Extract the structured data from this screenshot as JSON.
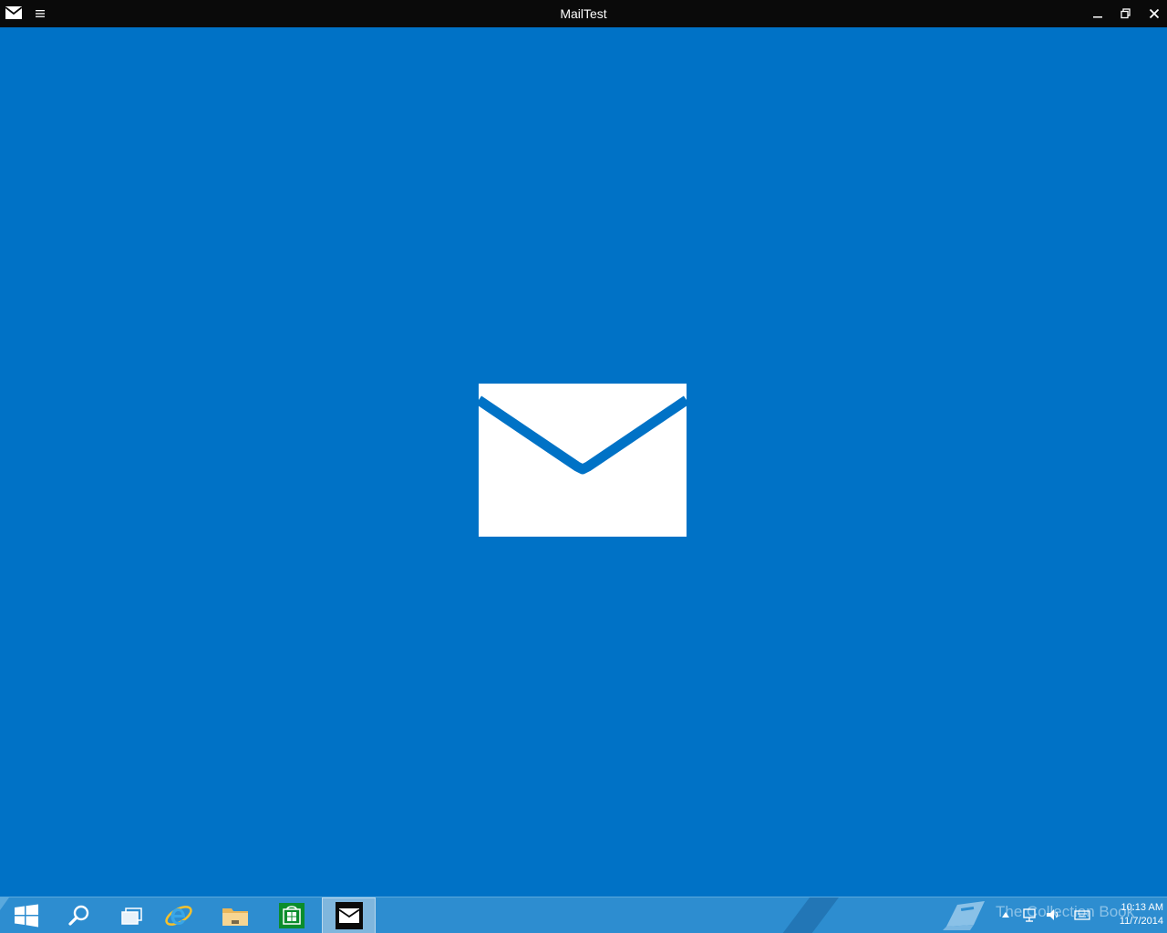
{
  "window": {
    "title": "MailTest",
    "app_icon": "mail-envelope-icon",
    "menu_icon": "hamburger-menu-icon",
    "controls": [
      "minimize-icon",
      "maximize-icon",
      "close-icon"
    ]
  },
  "splash": {
    "logo": "mail-envelope-icon",
    "background_color": "#0072c6"
  },
  "taskbar": {
    "items": [
      {
        "name": "start",
        "icon": "windows-logo-icon"
      },
      {
        "name": "search",
        "icon": "search-icon"
      },
      {
        "name": "task-view",
        "icon": "task-view-icon"
      },
      {
        "name": "internet-explorer",
        "icon": "internet-explorer-icon"
      },
      {
        "name": "file-explorer",
        "icon": "folder-icon"
      },
      {
        "name": "store",
        "icon": "store-bag-icon"
      },
      {
        "name": "mail",
        "icon": "mail-envelope-icon",
        "active": true
      }
    ],
    "tray": {
      "icons": [
        "show-hidden-icons-chevron",
        "network-icon",
        "volume-icon",
        "keyboard-icon"
      ],
      "time": "10:13 AM",
      "date": "11/7/2014"
    },
    "watermark": "The Collection Book",
    "accent_color": "#2d8dd0"
  }
}
